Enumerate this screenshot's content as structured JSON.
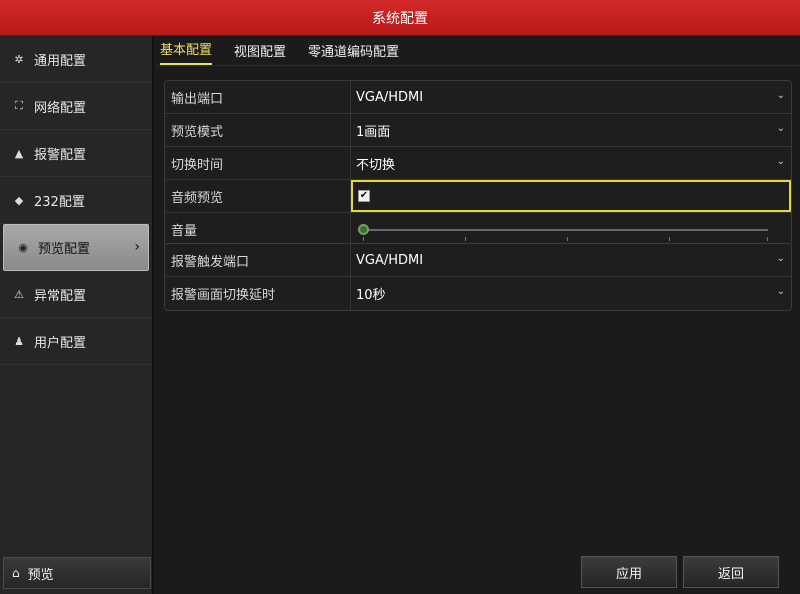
{
  "window": {
    "title": "系统配置"
  },
  "sidebar": {
    "items": [
      {
        "label": "通用配置",
        "icon": "gear-icon"
      },
      {
        "label": "网络配置",
        "icon": "network-icon"
      },
      {
        "label": "报警配置",
        "icon": "alarm-icon"
      },
      {
        "label": "232配置",
        "icon": "serial-icon"
      },
      {
        "label": "预览配置",
        "icon": "eye-icon",
        "active": true
      },
      {
        "label": "异常配置",
        "icon": "warning-icon"
      },
      {
        "label": "用户配置",
        "icon": "users-icon"
      }
    ],
    "bottom_label": "预览"
  },
  "tabs": [
    {
      "label": "基本配置",
      "active": true
    },
    {
      "label": "视图配置"
    },
    {
      "label": "零通道编码配置"
    }
  ],
  "form": {
    "output_port": {
      "label": "输出端口",
      "value": "VGA/HDMI"
    },
    "preview_mode": {
      "label": "预览模式",
      "value": "1画面"
    },
    "switch_time": {
      "label": "切换时间",
      "value": "不切换"
    },
    "audio_preview": {
      "label": "音频预览",
      "checked": true
    },
    "volume": {
      "label": "音量",
      "level": 0
    },
    "alarm_output_port": {
      "label": "报警触发端口",
      "value": "VGA/HDMI"
    },
    "alarm_switch_delay": {
      "label": "报警画面切换延时",
      "value": "10秒"
    }
  },
  "buttons": {
    "apply": "应用",
    "back": "返回"
  },
  "colors": {
    "title_bar": "#c41f1f",
    "active_tab": "#f0e05a",
    "focus_border": "#e3d93a"
  }
}
